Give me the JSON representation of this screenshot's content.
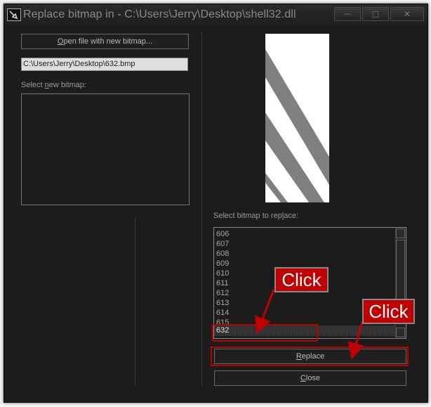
{
  "window": {
    "title": "Replace bitmap in - C:\\Users\\Jerry\\Desktop\\shell32.dll",
    "minimize_glyph": "—",
    "maximize_glyph": "□",
    "close_glyph": "✕"
  },
  "left_panel": {
    "open_button": {
      "prefix": "",
      "accel": "O",
      "rest": "pen file with new bitmap..."
    },
    "path_value": "C:\\Users\\Jerry\\Desktop\\632.bmp",
    "new_bitmap_label": {
      "prefix": "Select ",
      "accel": "n",
      "rest": "ew bitmap:"
    }
  },
  "right_panel": {
    "replace_label": {
      "prefix": "Select bitmap to rep",
      "accel": "l",
      "rest": "ace:"
    },
    "bitmap_list": [
      "606",
      "607",
      "608",
      "609",
      "610",
      "611",
      "612",
      "613",
      "614",
      "615"
    ],
    "selected_item": "632",
    "replace_button": {
      "prefix": "",
      "accel": "R",
      "rest": "eplace"
    },
    "close_button": {
      "prefix": "",
      "accel": "C",
      "rest": "lose"
    }
  },
  "annotations": {
    "callout_1": "Click",
    "callout_2": "Click",
    "color": "#c00000"
  }
}
